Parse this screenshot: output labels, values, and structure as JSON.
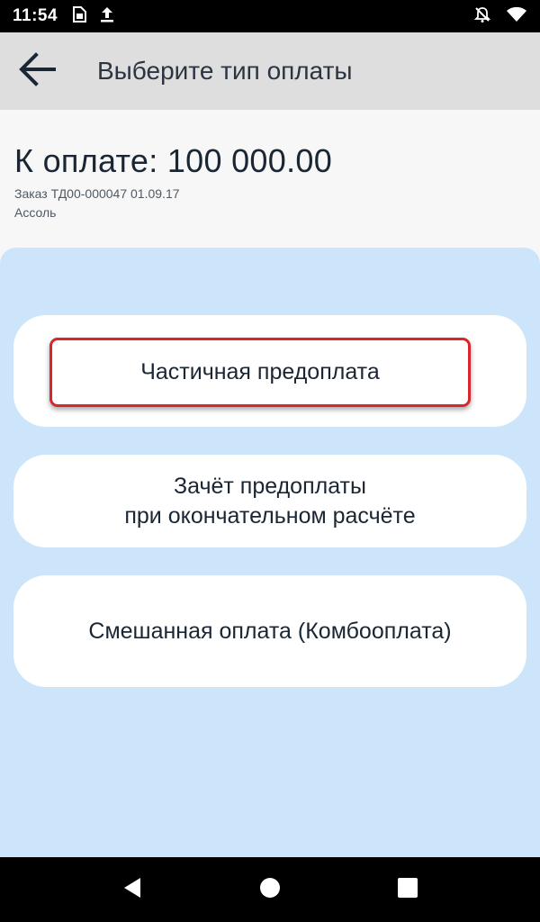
{
  "status_bar": {
    "time": "11:54",
    "left_icons": [
      "sim-card-icon",
      "upload-icon"
    ],
    "right_icons": [
      "notifications-off-icon",
      "wifi-icon"
    ]
  },
  "app_bar": {
    "back_icon": "arrow-back-icon",
    "title": "Выберите тип оплаты"
  },
  "summary": {
    "amount_text": "К оплате: 100 000.00",
    "order_text": "Заказ ТД00-000047 01.09.17",
    "client_text": "Ассоль"
  },
  "options": [
    {
      "lines": [
        "Частичная предоплата"
      ],
      "highlighted": true
    },
    {
      "lines": [
        "Зачёт предоплаты",
        "при окончательном расчёте"
      ],
      "highlighted": false
    },
    {
      "lines": [
        "Смешанная оплата (Комбооплата)"
      ],
      "highlighted": false
    }
  ],
  "nav_bar": {
    "icons": [
      "back-triangle-icon",
      "home-circle-icon",
      "recents-square-icon"
    ]
  },
  "colors": {
    "panel_bg": "#cce5fb",
    "app_bar_bg": "#dedede",
    "highlight_border": "#d8262c",
    "text_dark": "#1a2633"
  }
}
